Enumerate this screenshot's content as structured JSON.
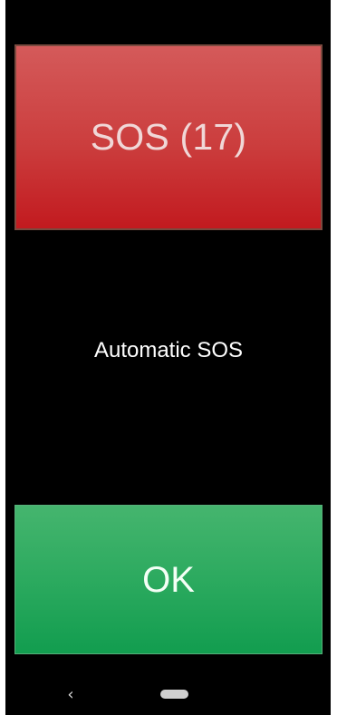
{
  "screen": {
    "sos_button": {
      "label": "SOS (17)"
    },
    "status_text": "Automatic SOS",
    "ok_button": {
      "label": "OK"
    },
    "navigation": {
      "back_icon": "‹",
      "home_icon": "home-pill"
    }
  },
  "colors": {
    "background": "#000000",
    "sos_button": "#c8282b",
    "ok_button": "#2caa5f",
    "text_light": "#ffffff"
  }
}
